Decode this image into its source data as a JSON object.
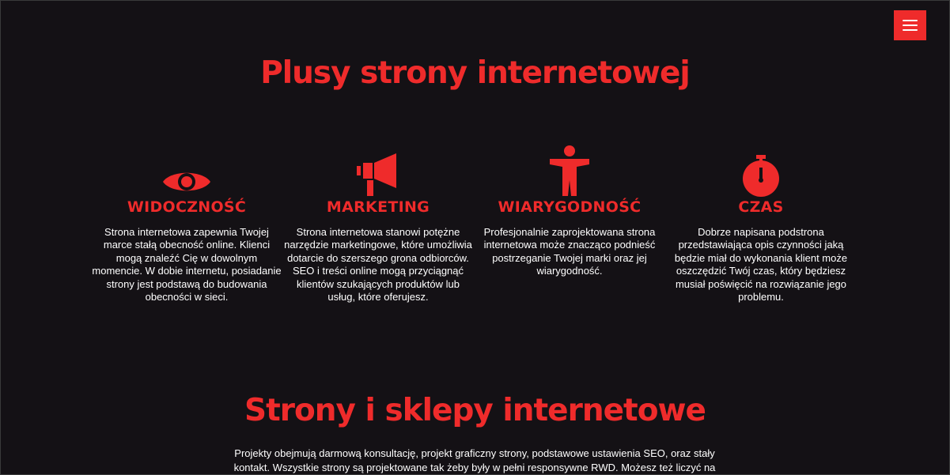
{
  "menu": {
    "icon": "hamburger-menu-icon",
    "color": "#ef2b2b"
  },
  "section1": {
    "title": "Plusy strony internetowej",
    "features": [
      {
        "icon": "eye-icon",
        "title": "WIDOCZNOŚĆ",
        "text": "Strona internetowa zapewnia Twojej marce stałą obecność online. Klienci mogą znaleźć Cię w dowolnym momencie. W dobie internetu, posiadanie strony jest podstawą do budowania obecności w sieci."
      },
      {
        "icon": "megaphone-icon",
        "title": "MARKETING",
        "text": "Strona internetowa stanowi potężne narzędzie marketingowe, które umożliwia dotarcie do szerszego grona odbiorców. SEO i treści online mogą przyciągnąć klientów szukających produktów lub usług, które oferujesz."
      },
      {
        "icon": "person-icon",
        "title": "WIARYGODNOŚĆ",
        "text": "Profesjonalnie zaprojektowana strona internetowa może znacząco podnieść postrzeganie Twojej marki oraz jej wiarygodność."
      },
      {
        "icon": "stopwatch-icon",
        "title": "CZAS",
        "text": "Dobrze napisana podstrona przedstawiająca opis czynności jaką będzie miał do wykonania klient może oszczędzić Twój czas, który będziesz musiał poświęcić na rozwiązanie jego problemu."
      }
    ]
  },
  "section2": {
    "title": "Strony i sklepy internetowe",
    "intro": "Projekty obejmują darmową konsultację, projekt graficzny strony, podstawowe ustawienia SEO, oraz stały kontakt. Wszystkie strony są projektowane tak żeby były w pełni responsywne RWD. Możesz też liczyć na"
  },
  "colors": {
    "background": "#141115",
    "accent": "#ef2b2b",
    "text": "#ffffff"
  }
}
